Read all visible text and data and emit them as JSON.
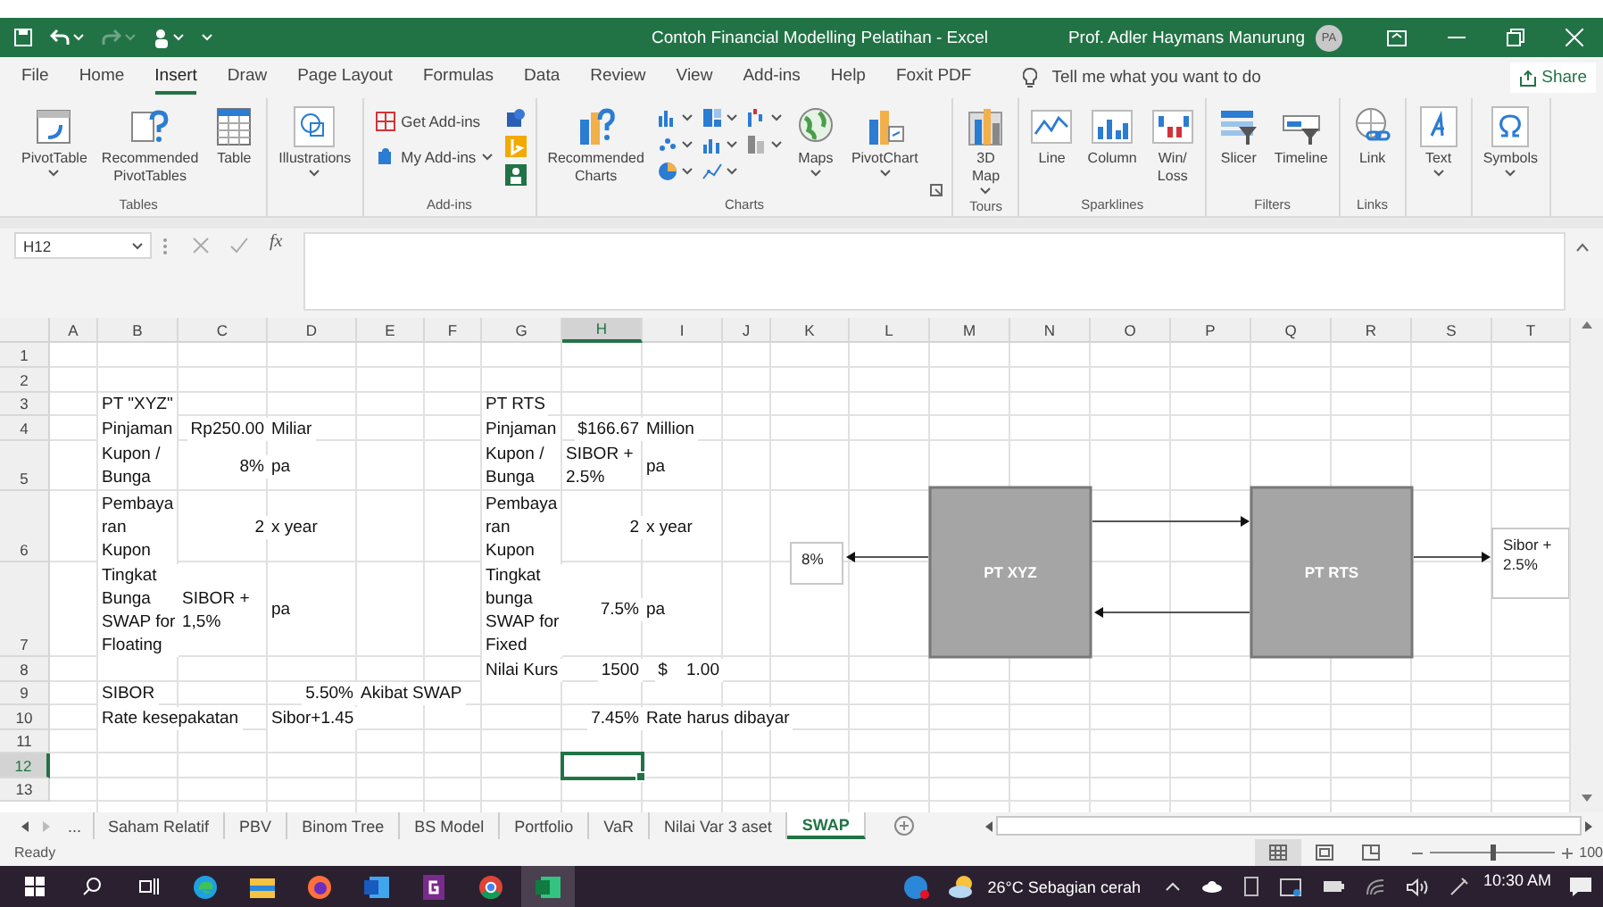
{
  "title_bar": {
    "title": "Contoh Financial Modelling Pelatihan  -  Excel",
    "user": "Prof. Adler Haymans Manurung",
    "avatar": "PA",
    "quick_access": [
      {
        "disabled": false,
        "dropdown": false
      },
      {
        "disabled": false,
        "dropdown": true
      },
      {
        "disabled": true,
        "dropdown": true
      },
      {
        "disabled": false,
        "dropdown": true
      },
      {
        "disabled": false,
        "dropdown": true
      }
    ]
  },
  "menu_tabs": [
    {
      "label": "File",
      "selected": false
    },
    {
      "label": "Home",
      "selected": false
    },
    {
      "label": "Insert",
      "selected": true
    },
    {
      "label": "Draw",
      "selected": false
    },
    {
      "label": "Page Layout",
      "selected": false
    },
    {
      "label": "Formulas",
      "selected": false
    },
    {
      "label": "Data",
      "selected": false
    },
    {
      "label": "Review",
      "selected": false
    },
    {
      "label": "View",
      "selected": false
    },
    {
      "label": "Add-ins",
      "selected": false
    },
    {
      "label": "Help",
      "selected": false
    },
    {
      "label": "Foxit PDF",
      "selected": false
    }
  ],
  "tell_me": "Tell me what you want to do",
  "share": "Share",
  "ribbon": {
    "groups": [
      {
        "kind": "large",
        "label": "Tables",
        "items": [
          {
            "label": "PivotTable",
            "dropdown": true
          },
          {
            "label": "Recommended\nPivotTables",
            "dropdown": false
          },
          {
            "label": "Table",
            "dropdown": false
          }
        ]
      },
      {
        "kind": "large",
        "items": [
          {
            "label": "Illustrations",
            "dropdown": true
          }
        ]
      },
      {
        "kind": "addins",
        "label": "Add-ins",
        "items": [
          {
            "label": "Get Add-ins",
            "dropdown": false
          },
          {
            "label": "My Add-ins",
            "dropdown": true
          }
        ]
      },
      {
        "kind": "charts",
        "label": "Charts",
        "items": [
          {
            "label": "Recommended\nCharts",
            "dropdown": false
          },
          {
            "label": "Maps",
            "dropdown": true
          },
          {
            "label": "PivotChart",
            "dropdown": true
          }
        ]
      },
      {
        "kind": "large",
        "label": "Tours",
        "items": [
          {
            "label": "3D\nMap",
            "dropdown": true
          }
        ]
      },
      {
        "kind": "large",
        "label": "Sparklines",
        "items": [
          {
            "label": "Line",
            "dropdown": false
          },
          {
            "label": "Column",
            "dropdown": false
          },
          {
            "label": "Win/\nLoss",
            "dropdown": false
          }
        ]
      },
      {
        "kind": "large",
        "label": "Filters",
        "items": [
          {
            "label": "Slicer",
            "dropdown": false
          },
          {
            "label": "Timeline",
            "dropdown": false
          }
        ]
      },
      {
        "kind": "large",
        "label": "Links",
        "items": [
          {
            "label": "Link",
            "dropdown": false
          }
        ]
      },
      {
        "kind": "large",
        "items": [
          {
            "label": "Text",
            "dropdown": true
          }
        ]
      },
      {
        "kind": "large",
        "items": [
          {
            "label": "Symbols",
            "dropdown": true
          }
        ]
      }
    ]
  },
  "formula_bar": {
    "name_box": "H12",
    "function_label": "fx"
  },
  "columns": [
    {
      "label": "A",
      "selected": false
    },
    {
      "label": "B",
      "selected": false
    },
    {
      "label": "C",
      "selected": false
    },
    {
      "label": "D",
      "selected": false
    },
    {
      "label": "E",
      "selected": false
    },
    {
      "label": "F",
      "selected": false
    },
    {
      "label": "G",
      "selected": false
    },
    {
      "label": "H",
      "selected": true
    },
    {
      "label": "I",
      "selected": false
    },
    {
      "label": "J",
      "selected": false
    },
    {
      "label": "K",
      "selected": false
    },
    {
      "label": "L",
      "selected": false
    },
    {
      "label": "M",
      "selected": false
    },
    {
      "label": "N",
      "selected": false
    },
    {
      "label": "O",
      "selected": false
    },
    {
      "label": "P",
      "selected": false
    },
    {
      "label": "Q",
      "selected": false
    },
    {
      "label": "R",
      "selected": false
    },
    {
      "label": "S",
      "selected": false
    },
    {
      "label": "T",
      "selected": false
    }
  ],
  "rows": [
    {
      "number": "1",
      "selected": false,
      "cells": {}
    },
    {
      "number": "2",
      "selected": false,
      "cells": {}
    },
    {
      "number": "3",
      "selected": false,
      "cells": {
        "B": {
          "text": "PT \"XYZ\"",
          "selected": false
        },
        "G": {
          "text": "PT RTS",
          "selected": false
        }
      }
    },
    {
      "number": "4",
      "selected": false,
      "cells": {
        "B": {
          "text": "Pinjaman",
          "selected": false
        },
        "C": {
          "text": "Rp250.00",
          "kind": "number",
          "selected": false
        },
        "D": {
          "text": "Miliar",
          "selected": false
        },
        "G": {
          "text": "Pinjaman",
          "selected": false
        },
        "H": {
          "text": "$166.67",
          "kind": "number",
          "selected": false
        },
        "I": {
          "text": "Million",
          "selected": false
        }
      }
    },
    {
      "number": "5",
      "selected": false,
      "cells": {
        "B": {
          "text": "Kupon /\nBunga",
          "selected": false
        },
        "C": {
          "text": "8%",
          "kind": "number",
          "selected": false
        },
        "D": {
          "text": "pa",
          "selected": false
        },
        "G": {
          "text": "Kupon /\nBunga",
          "selected": false
        },
        "H": {
          "text": "SIBOR +\n2.5%",
          "selected": false
        },
        "I": {
          "text": "pa",
          "selected": false
        }
      }
    },
    {
      "number": "6",
      "selected": false,
      "cells": {
        "B": {
          "text": "Pembaya\nran\nKupon",
          "selected": false
        },
        "C": {
          "text": "2",
          "kind": "number",
          "selected": false
        },
        "D": {
          "text": "x year",
          "selected": false
        },
        "G": {
          "text": "Pembaya\nran\nKupon",
          "selected": false
        },
        "H": {
          "text": "2",
          "kind": "number",
          "selected": false
        },
        "I": {
          "text": "x year",
          "selected": false
        }
      }
    },
    {
      "number": "7",
      "selected": false,
      "cells": {
        "B": {
          "text": "Tingkat\nBunga\nSWAP for\nFloating",
          "selected": false
        },
        "C": {
          "text": "SIBOR +\n1,5%",
          "selected": false
        },
        "D": {
          "text": "pa",
          "selected": false
        },
        "G": {
          "text": "Tingkat\nbunga\nSWAP for\nFixed",
          "selected": false
        },
        "H": {
          "text": "7.5%",
          "kind": "number",
          "selected": false
        },
        "I": {
          "text": "pa",
          "selected": false
        }
      }
    },
    {
      "number": "8",
      "selected": false,
      "cells": {
        "G": {
          "text": "Nilai Kurs",
          "selected": false
        },
        "H": {
          "text": "1500",
          "kind": "number",
          "selected": false
        },
        "I": {
          "text": "$    1.00",
          "kind": "number",
          "selected": false
        }
      }
    },
    {
      "number": "9",
      "selected": false,
      "cells": {
        "B": {
          "text": "SIBOR",
          "selected": false
        },
        "D": {
          "text": "5.50%",
          "kind": "number",
          "selected": false
        },
        "E": {
          "text": "Akibat SWAP",
          "selected": false
        }
      }
    },
    {
      "number": "10",
      "selected": false,
      "cells": {
        "B": {
          "text": "Rate kesepakatan",
          "selected": false
        },
        "D": {
          "text": "Sibor+1.45",
          "selected": false
        },
        "H": {
          "text": "7.45%",
          "kind": "number",
          "selected": false
        },
        "I": {
          "text": "Rate harus dibayar",
          "selected": false
        }
      }
    },
    {
      "number": "11",
      "selected": false,
      "cells": {}
    },
    {
      "number": "12",
      "selected": true,
      "cells": {
        "H": {
          "selected": true
        }
      }
    },
    {
      "number": "13",
      "selected": false,
      "cells": {}
    }
  ],
  "diagram": {
    "nodes": [
      {
        "kind": "callout",
        "text": "8%"
      },
      {
        "kind": "process",
        "text": "PT XYZ"
      },
      {
        "kind": "process",
        "text": "PT RTS"
      },
      {
        "kind": "callout",
        "text": "Sibor +\n2.5%"
      }
    ]
  },
  "sheet_tabs": {
    "more": "...",
    "tabs": [
      {
        "label": "Saham Relatif",
        "selected": false
      },
      {
        "label": "PBV",
        "selected": false
      },
      {
        "label": "Binom Tree",
        "selected": false
      },
      {
        "label": "BS Model",
        "selected": false
      },
      {
        "label": "Portfolio",
        "selected": false
      },
      {
        "label": "VaR",
        "selected": false
      },
      {
        "label": "Nilai Var 3 aset",
        "selected": false
      },
      {
        "label": "SWAP",
        "selected": true
      }
    ]
  },
  "status_bar": {
    "status": "Ready",
    "views": [
      {
        "selected": true
      },
      {
        "selected": false
      },
      {
        "selected": false
      }
    ],
    "zoom": {
      "level": 0.5,
      "label": "100"
    }
  },
  "taskbar": {
    "apps": [
      {
        "selected": false
      },
      {
        "selected": false
      },
      {
        "selected": false
      },
      {
        "selected": false
      },
      {
        "selected": false
      },
      {
        "selected": false
      },
      {
        "selected": true
      }
    ],
    "weather": "26°C  Sebagian cerah",
    "time": "10:30 AM"
  }
}
